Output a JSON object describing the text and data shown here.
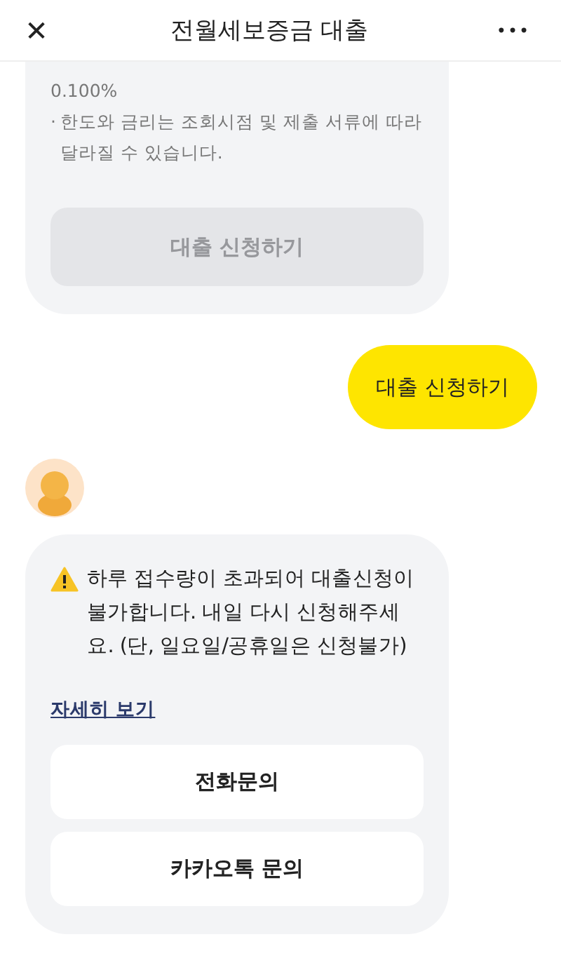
{
  "header": {
    "close": "✕",
    "title": "전월세보증금 대출",
    "more": "•••"
  },
  "info_card": {
    "lines": [
      {
        "text": "0.100%"
      },
      {
        "bullet": "·",
        "text": "한도와 금리는 조회시점 및 제출 서류에 따라 달라질 수 있습니다."
      }
    ],
    "button": {
      "label": "대출 신청하기",
      "disabled": true
    }
  },
  "user_message": "대출 신청하기",
  "bot_card": {
    "warning": true,
    "message": "하루 접수량이 초과되어 대출신청이 불가합니다. 내일 다시 신청해주세요. (단, 일요일/공휴일은 신청불가)",
    "link": "자세히 보기",
    "buttons": [
      "전화문의",
      "카카오톡 문의"
    ]
  }
}
